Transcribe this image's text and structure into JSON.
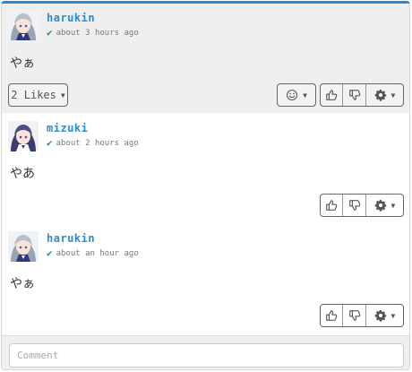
{
  "posts": [
    {
      "username": "harukin",
      "time": "about 3 hours ago",
      "body": "やぁ",
      "likes_label": "2 Likes"
    },
    {
      "username": "mizuki",
      "time": "about 2 hours ago",
      "body": "やあ"
    },
    {
      "username": "harukin",
      "time": "about an hour ago",
      "body": "やぁ"
    }
  ],
  "comment": {
    "placeholder": "Comment"
  },
  "icons": {
    "check": "check-icon",
    "smiley": "smiley-icon",
    "thumbs_up": "thumbs-up-icon",
    "thumbs_down": "thumbs-down-icon",
    "gear": "gear-icon",
    "caret": "caret-down-icon"
  },
  "colors": {
    "accent": "#2a8ad4",
    "check": "#2d9a3a",
    "highlight_bg": "#efefef"
  }
}
